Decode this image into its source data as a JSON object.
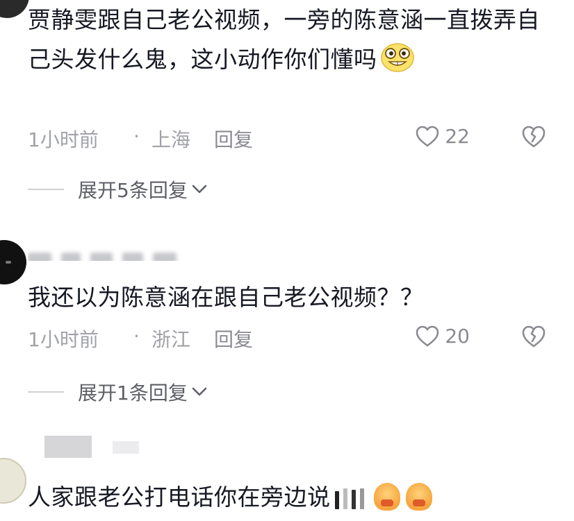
{
  "comments": [
    {
      "text": "贾静雯跟自己老公视频，一旁的陈意涵一直拨弄自己头发什么鬼，这小动作你们懂吗",
      "time": "1小时前",
      "separator": "·",
      "location": "上海",
      "reply_label": "回复",
      "likes": "22",
      "expand_label": "展开5条回复"
    },
    {
      "text": "我还以为陈意涵在跟自己老公视频？？",
      "time": "1小时前",
      "separator": "·",
      "location": "浙江",
      "reply_label": "回复",
      "likes": "20",
      "expand_label": "展开1条回复"
    },
    {
      "text": "人家跟老公打电话你在旁边说"
    }
  ],
  "icons": {
    "like": "heart-outline-icon",
    "dislike": "broken-heart-icon",
    "expand": "chevron-down-icon",
    "emoji": "grinning-emoji-icon"
  },
  "colors": {
    "text": "#161823",
    "meta": "#a1a2a7",
    "action": "#8a8b91"
  }
}
